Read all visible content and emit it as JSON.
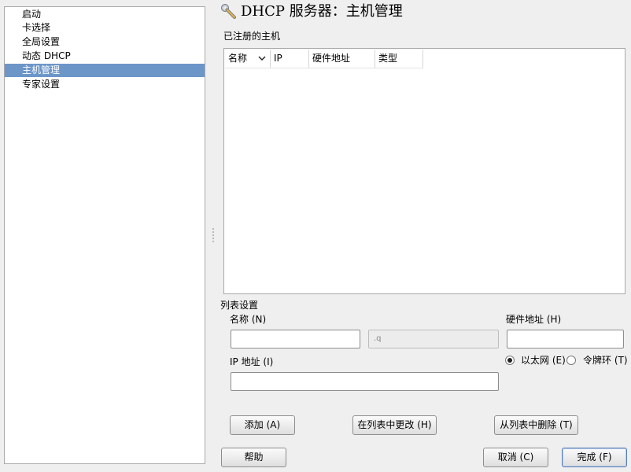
{
  "sidebar": {
    "items": [
      {
        "label": "启动"
      },
      {
        "label": "卡选择"
      },
      {
        "label": "全局设置"
      },
      {
        "label": "动态 DHCP"
      },
      {
        "label": "主机管理",
        "active": true
      },
      {
        "label": "专家设置"
      }
    ]
  },
  "header": {
    "title": "DHCP 服务器：主机管理",
    "icon": "wrench-icon"
  },
  "hosts": {
    "heading": "已注册的主机",
    "columns": [
      "名称",
      "IP",
      "硬件地址",
      "类型"
    ],
    "rows": []
  },
  "form": {
    "section_label": "列表设置",
    "name_label": "名称 (N)",
    "name_value": "",
    "domain_value": ".q",
    "hwaddr_label": "硬件地址 (H)",
    "hwaddr_value": "",
    "ip_label": "IP 地址 (I)",
    "ip_value": "",
    "type_options": [
      {
        "label": "以太网 (E)",
        "checked": true
      },
      {
        "label": "令牌环 (T)",
        "checked": false
      }
    ],
    "add_button": "添加 (A)",
    "change_button": "在列表中更改 (H)",
    "delete_button": "从列表中删除 (T)"
  },
  "footer": {
    "help_button": "帮助",
    "cancel_button": "取消 (C)",
    "finish_button": "完成 (F)"
  }
}
